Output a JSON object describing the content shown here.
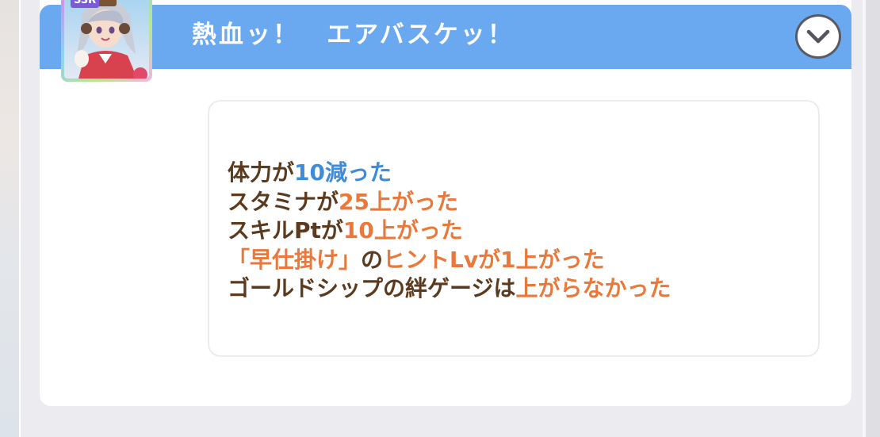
{
  "event": {
    "title": "熱血ッ！　エアバスケッ！",
    "card_rarity": "SSR"
  },
  "colors": {
    "header": "#6aa9ef",
    "text_brown": "#5b3a1e",
    "decrease_blue": "#3e8bd8",
    "increase_orange": "#e9783a"
  },
  "icons": {
    "collapse": "chevron-down-icon",
    "avatar": "character-portrait-icon"
  },
  "results": [
    {
      "label": "体力が",
      "value": "10減った",
      "tone": "blue",
      "suffix": ""
    },
    {
      "label": "スタミナが",
      "value": "25上がった",
      "tone": "orange",
      "suffix": ""
    },
    {
      "label": "スキルPtが",
      "value": "10上がった",
      "tone": "orange",
      "suffix": ""
    },
    {
      "label": "",
      "value": "「早仕掛け」",
      "tone": "orange",
      "mid": "の",
      "value2": "ヒントLvが1上がった"
    },
    {
      "label": "ゴールドシップの絆ゲージは",
      "value": "上がらなかった",
      "tone": "orange",
      "suffix": ""
    }
  ]
}
